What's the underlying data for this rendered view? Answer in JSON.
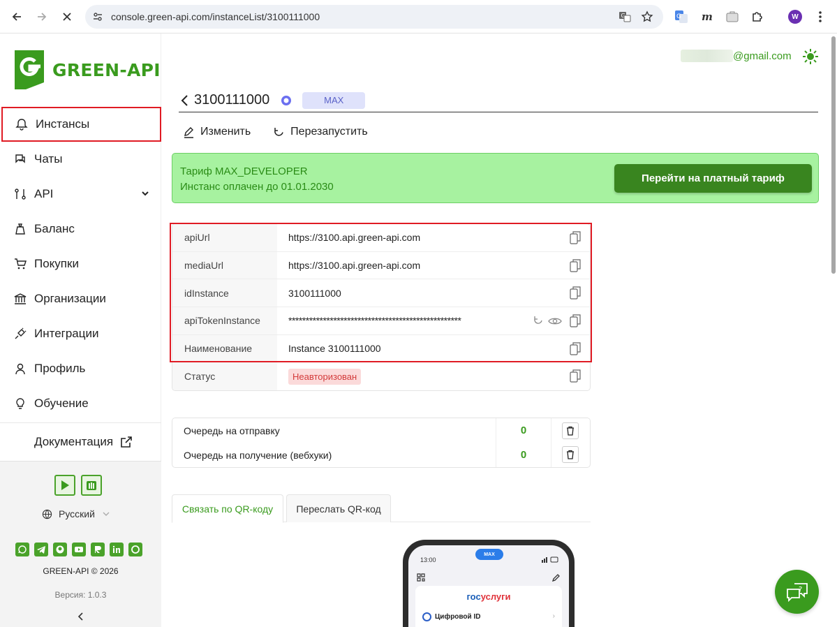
{
  "browser": {
    "url": "console.green-api.com/instanceList/3100111000",
    "profile_initial": "W"
  },
  "sidebar": {
    "brand": "GREEN-API",
    "items": [
      {
        "label": "Инстансы",
        "icon": "bell-icon",
        "active": true
      },
      {
        "label": "Чаты",
        "icon": "chat-icon"
      },
      {
        "label": "API",
        "icon": "api-icon",
        "expandable": true
      },
      {
        "label": "Баланс",
        "icon": "wallet-icon"
      },
      {
        "label": "Покупки",
        "icon": "cart-icon"
      },
      {
        "label": "Организации",
        "icon": "bank-icon"
      },
      {
        "label": "Интеграции",
        "icon": "plug-icon"
      },
      {
        "label": "Профиль",
        "icon": "user-icon"
      },
      {
        "label": "Обучение",
        "icon": "bulb-icon"
      }
    ],
    "docs_label": "Документация",
    "language": "Русский",
    "copyright": "GREEN-API © 2026",
    "version": "Версия: 1.0.3"
  },
  "header": {
    "account_email": "@gmail.com"
  },
  "instance": {
    "id": "3100111000",
    "platform_badge": "MAX",
    "edit_label": "Изменить",
    "restart_label": "Перезапустить"
  },
  "tariff": {
    "line1": "Тариф MAX_DEVELOPER",
    "line2": "Инстанс оплачен до 01.01.2030",
    "button": "Перейти на платный тариф"
  },
  "info": {
    "rows": [
      {
        "key": "apiUrl",
        "value": "https://3100.api.green-api.com"
      },
      {
        "key": "mediaUrl",
        "value": "https://3100.api.green-api.com"
      },
      {
        "key": "idInstance",
        "value": "3100111000"
      },
      {
        "key": "apiTokenInstance",
        "value": "**************************************************"
      },
      {
        "key": "Наименование",
        "value": "Instance 3100111000"
      },
      {
        "key": "Статус",
        "value": "Неавторизован"
      }
    ]
  },
  "queue": {
    "send_label": "Очередь на отправку",
    "send_value": "0",
    "receive_label": "Очередь на получение (вебхуки)",
    "receive_value": "0"
  },
  "tabs": [
    {
      "label": "Связать по QR-коду",
      "active": true
    },
    {
      "label": "Переслать QR-код",
      "active": false
    }
  ],
  "phone": {
    "time": "13:00",
    "pill": "MAX",
    "gos_a": "гос",
    "gos_b": "услуги",
    "digital_id": "Цифровой ID"
  },
  "colors": {
    "brand_green": "#3a9b1e",
    "highlight_red": "#e01b24",
    "tariff_bg": "#a7f2a0"
  }
}
